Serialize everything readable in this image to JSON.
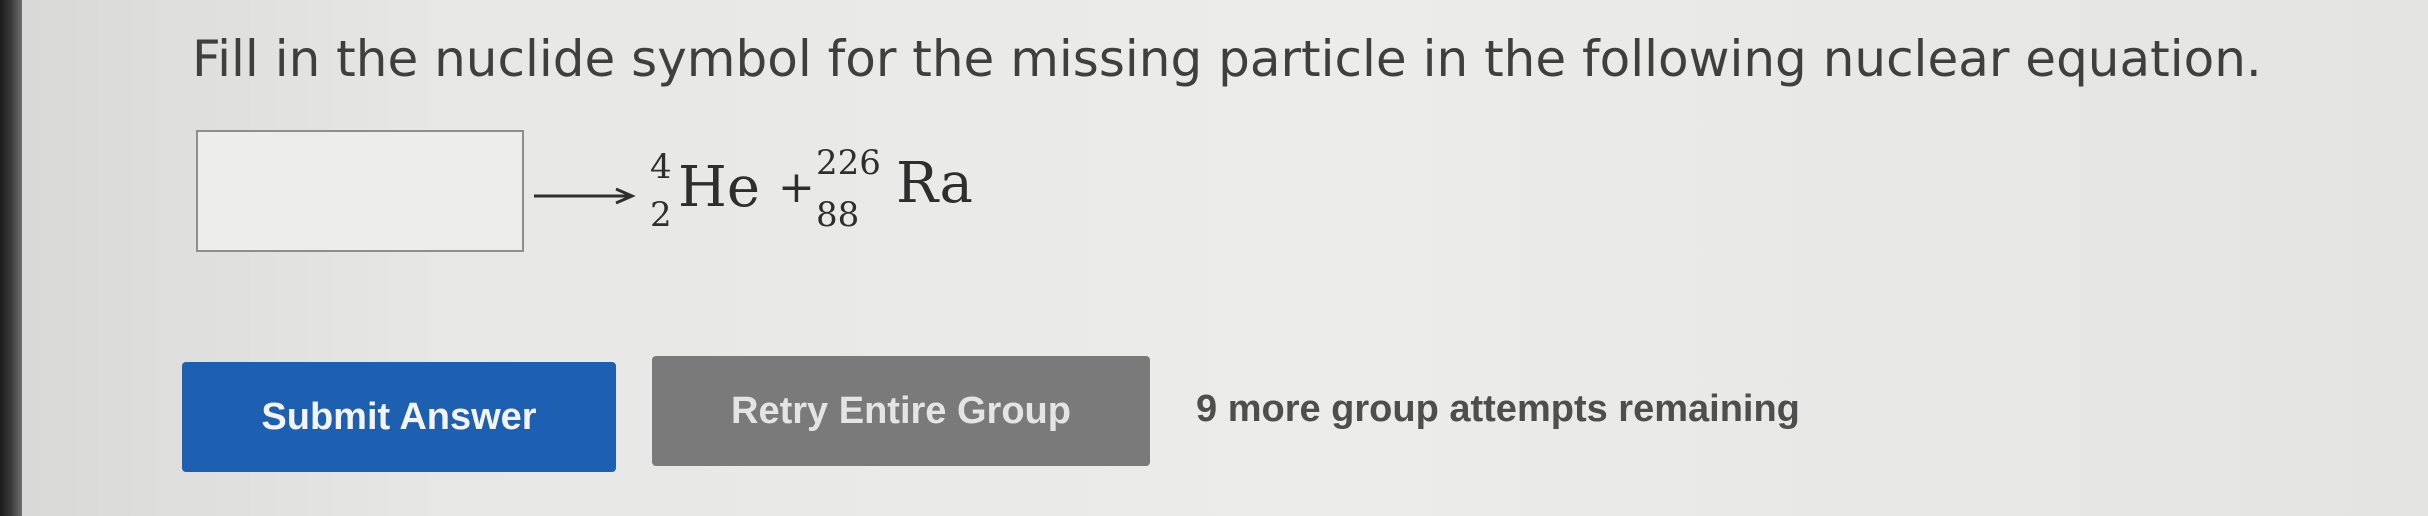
{
  "question": {
    "text": "Fill in the nuclide symbol for the missing particle in the following nuclear equation."
  },
  "equation": {
    "answer_value": "",
    "arrow_icon": "right-arrow-icon",
    "product1": {
      "mass": "4",
      "atomic": "2",
      "symbol": "He"
    },
    "plus": "+",
    "product2": {
      "mass": "226",
      "atomic": "88",
      "symbol": "Ra"
    }
  },
  "buttons": {
    "submit": "Submit Answer",
    "retry": "Retry Entire Group"
  },
  "status": {
    "attempts": "9 more group attempts remaining"
  },
  "colors": {
    "submit_bg": "#1d5fb0",
    "retry_bg": "#7a7a7a"
  }
}
